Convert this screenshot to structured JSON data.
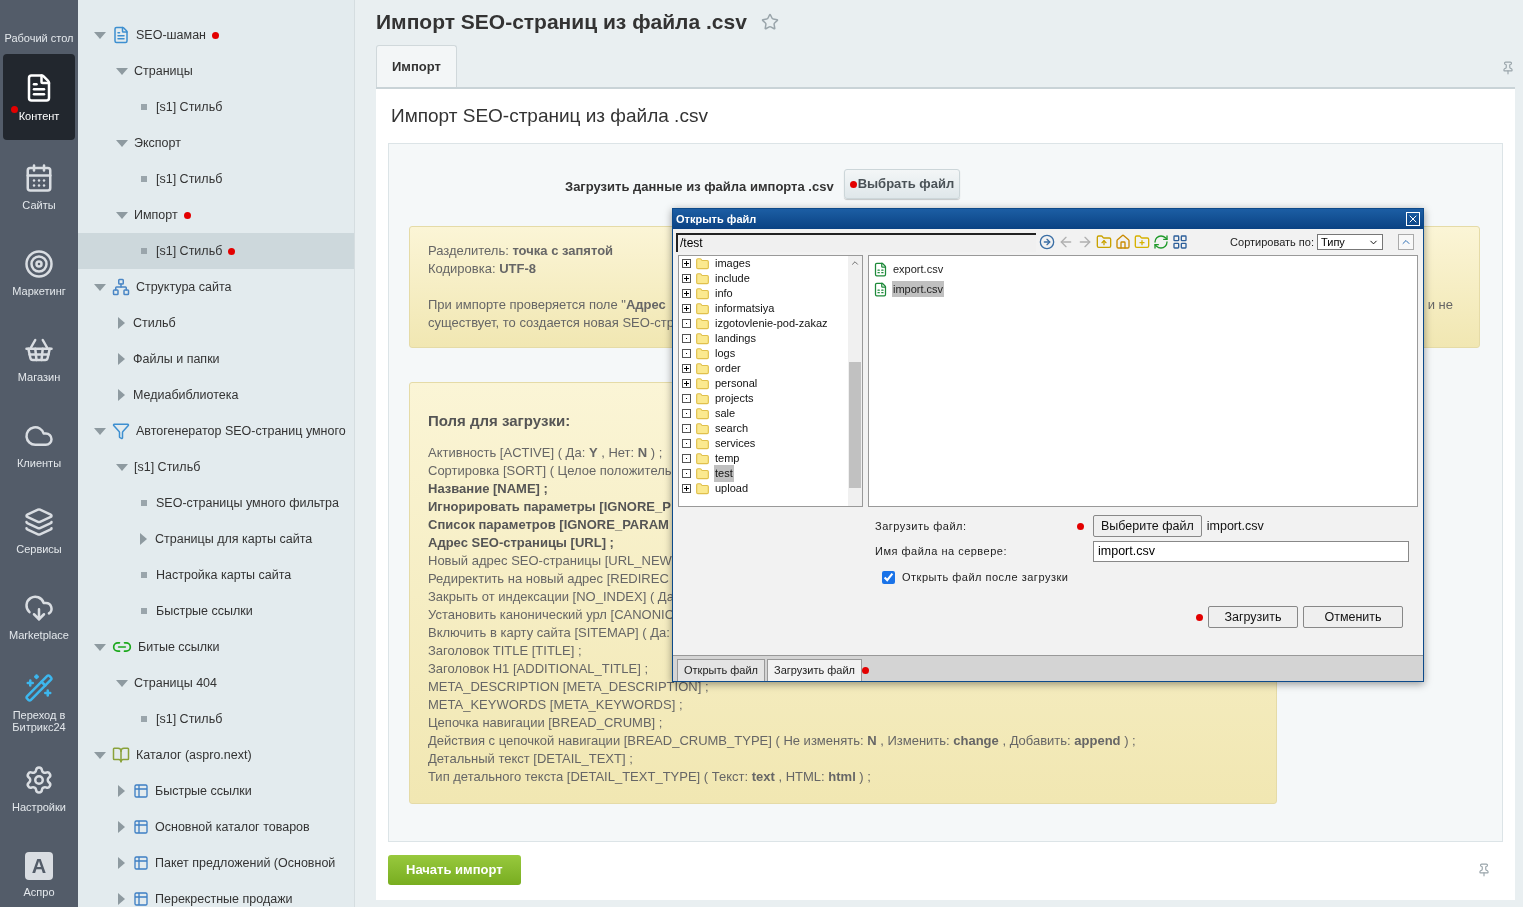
{
  "nav": [
    {
      "label": "Рабочий стол",
      "selected": false,
      "marked": false
    },
    {
      "label": "Контент",
      "selected": true,
      "marked": true
    },
    {
      "label": "Сайты",
      "selected": false,
      "marked": false
    },
    {
      "label": "Маркетинг",
      "selected": false,
      "marked": false
    },
    {
      "label": "Магазин",
      "selected": false,
      "marked": false
    },
    {
      "label": "Клиенты",
      "selected": false,
      "marked": false
    },
    {
      "label": "Сервисы",
      "selected": false,
      "marked": false
    },
    {
      "label": "Marketplace",
      "selected": false,
      "marked": false
    },
    {
      "label": "Переход в Битрикс24",
      "selected": false,
      "marked": false
    },
    {
      "label": "Настройки",
      "selected": false,
      "marked": false
    },
    {
      "label": "Аспро",
      "letter": "A",
      "selected": false,
      "marked": false
    }
  ],
  "tree": [
    {
      "label": "SEO-шаман",
      "kind": "folder",
      "expanded": true,
      "marked": true,
      "selected": false,
      "children": [
        {
          "label": "Страницы",
          "kind": "folder",
          "expanded": true,
          "marked": false,
          "selected": false,
          "children": [
            {
              "label": "[s1] Стильб",
              "kind": "leaf",
              "marked": false,
              "selected": false
            }
          ]
        },
        {
          "label": "Экспорт",
          "kind": "folder",
          "expanded": true,
          "marked": false,
          "selected": false,
          "children": [
            {
              "label": "[s1] Стильб",
              "kind": "leaf",
              "marked": false,
              "selected": false
            }
          ]
        },
        {
          "label": "Импорт",
          "kind": "folder",
          "expanded": true,
          "marked": true,
          "selected": false,
          "children": [
            {
              "label": "[s1] Стильб",
              "kind": "leaf",
              "marked": true,
              "selected": true
            }
          ]
        }
      ]
    },
    {
      "label": "Структура сайта",
      "kind": "folder",
      "expanded": true,
      "marked": false,
      "selected": false,
      "children": [
        {
          "label": "Стильб",
          "kind": "folder",
          "expanded": false,
          "marked": false,
          "selected": false
        },
        {
          "label": "Файлы и папки",
          "kind": "folder",
          "expanded": false,
          "marked": false,
          "selected": false
        },
        {
          "label": "Медиабиблиотека",
          "kind": "folder",
          "expanded": false,
          "marked": false,
          "selected": false
        }
      ]
    },
    {
      "label": "Автогенератор SEO-страниц умного",
      "kind": "folder",
      "expanded": true,
      "marked": false,
      "selected": false,
      "children": [
        {
          "label": "[s1] Стильб",
          "kind": "folder",
          "expanded": true,
          "marked": false,
          "selected": false,
          "children": [
            {
              "label": "SEO-страницы умного фильтра",
              "kind": "leaf",
              "marked": false,
              "selected": false
            },
            {
              "label": "Страницы для карты сайта",
              "kind": "folder",
              "expanded": false,
              "marked": false,
              "selected": false
            },
            {
              "label": "Настройка карты сайта",
              "kind": "leaf",
              "marked": false,
              "selected": false
            },
            {
              "label": "Быстрые ссылки",
              "kind": "leaf",
              "marked": false,
              "selected": false
            }
          ]
        }
      ]
    },
    {
      "label": "Битые ссылки",
      "kind": "folder",
      "expanded": true,
      "marked": false,
      "selected": false,
      "children": [
        {
          "label": "Страницы 404",
          "kind": "folder",
          "expanded": true,
          "marked": false,
          "selected": false,
          "children": [
            {
              "label": "[s1] Стильб",
              "kind": "leaf",
              "marked": false,
              "selected": false
            }
          ]
        }
      ]
    },
    {
      "label": "Каталог (aspro.next)",
      "kind": "folder",
      "expanded": true,
      "marked": false,
      "selected": false,
      "children": [
        {
          "label": "Быстрые ссылки",
          "kind": "folder",
          "expanded": false,
          "marked": false,
          "selected": false
        },
        {
          "label": "Основной каталог товаров",
          "kind": "folder",
          "expanded": false,
          "marked": false,
          "selected": false
        },
        {
          "label": "Пакет предложений (Основной",
          "kind": "folder",
          "expanded": false,
          "marked": false,
          "selected": false
        },
        {
          "label": "Перекрестные продажи",
          "kind": "folder",
          "expanded": false,
          "marked": false,
          "selected": false
        }
      ]
    }
  ],
  "page": {
    "title": "Импорт SEO-страниц из файла .csv",
    "tabs": [
      {
        "label": "Импорт",
        "selected": true
      }
    ],
    "heading": "Импорт SEO-страниц из файла .csv",
    "upload_label": "Загрузить данные из файла импорта .csv",
    "upload_button": {
      "label": "Выбрать файл",
      "marked": true
    },
    "info_lines": [
      "Разделитель: **точка с запятой**",
      "Кодировка: **UTF-8**"
    ],
    "info_paragraph": [
      "При импорте проверяется поле \"**Адрес**",
      "существует, то создается новая SEO-стр"
    ],
    "info_paragraph_tail": "и не",
    "fields_title": "Поля для загрузки:",
    "fields": [
      {
        "text": "Активность [ACTIVE] ( Да: **Y** , Нет: **N** ) ;",
        "bold": false
      },
      {
        "text": "Сортировка [SORT] ( Целое положитель",
        "bold": false
      },
      {
        "text": "Название [NAME] ;",
        "bold": true
      },
      {
        "text": "Игнорировать параметры [IGNORE_P",
        "bold": true
      },
      {
        "text": "Список параметров [IGNORE_PARAM",
        "bold": true
      },
      {
        "text": "Адрес SEO-страницы [URL] ;",
        "bold": true
      },
      {
        "text": "Новый адрес SEO-страницы [URL_NEW",
        "bold": false
      },
      {
        "text": "Редиректить на новый адрес [REDIREC",
        "bold": false
      },
      {
        "text": "Закрыть от индексации [NO_INDEX] ( Да",
        "bold": false
      },
      {
        "text": "Установить канонический урл [CANONIC",
        "bold": false
      },
      {
        "text": "Включить в карту сайта [SITEMAP] ( Да:",
        "bold": false
      },
      {
        "text": "Заголовок TITLE [TITLE] ;",
        "bold": false
      },
      {
        "text": "Заголовок H1 [ADDITIONAL_TITLE] ;",
        "bold": false
      },
      {
        "text": "META_DESCRIPTION [META_DESCRIPTION] ;",
        "bold": false
      },
      {
        "text": "META_KEYWORDS [META_KEYWORDS] ;",
        "bold": false
      },
      {
        "text": "Цепочка навигации [BREAD_CRUMB] ;",
        "bold": false
      },
      {
        "text": "Действия с цепочкой навигации [BREAD_CRUMB_TYPE] ( Не изменять: **N** , Изменить: **change** , Добавить: **append** ) ;",
        "bold": false
      },
      {
        "text": "Детальный текст [DETAIL_TEXT] ;",
        "bold": false
      },
      {
        "text": "Тип детального текста [DETAIL_TEXT_TYPE] ( Текст: **text** , HTML: **html** ) ;",
        "bold": false
      }
    ],
    "start_button": "Начать импорт"
  },
  "dialog": {
    "title": "Открыть файл",
    "path": "/test",
    "sort_label": "Сортировать по:",
    "sort_value": "Типу",
    "folders": [
      {
        "name": "images",
        "expandable": true,
        "selected": false
      },
      {
        "name": "include",
        "expandable": true,
        "selected": false
      },
      {
        "name": "info",
        "expandable": true,
        "selected": false
      },
      {
        "name": "informatsiya",
        "expandable": true,
        "selected": false
      },
      {
        "name": "izgotovlenie-pod-zakaz",
        "expandable": false,
        "selected": false
      },
      {
        "name": "landings",
        "expandable": false,
        "selected": false
      },
      {
        "name": "logs",
        "expandable": false,
        "selected": false
      },
      {
        "name": "order",
        "expandable": true,
        "selected": false
      },
      {
        "name": "personal",
        "expandable": true,
        "selected": false
      },
      {
        "name": "projects",
        "expandable": false,
        "selected": false
      },
      {
        "name": "sale",
        "expandable": false,
        "selected": false
      },
      {
        "name": "search",
        "expandable": false,
        "selected": false
      },
      {
        "name": "services",
        "expandable": false,
        "selected": false
      },
      {
        "name": "temp",
        "expandable": false,
        "selected": false
      },
      {
        "name": "test",
        "expandable": false,
        "selected": true
      },
      {
        "name": "upload",
        "expandable": true,
        "selected": false
      }
    ],
    "files": [
      {
        "name": "export.csv",
        "selected": false
      },
      {
        "name": "import.csv",
        "selected": true
      }
    ],
    "upload_label": "Загрузить файл:",
    "choose_button": {
      "label": "Выберите файл",
      "marked": true
    },
    "chosen_file": "import.csv",
    "server_name_label": "Имя файла на сервере:",
    "server_name": "import.csv",
    "open_after": {
      "label": "Открыть файл после загрузки",
      "checked": true
    },
    "buttons": [
      {
        "label": "Загрузить",
        "marked": true
      },
      {
        "label": "Отменить",
        "marked": false
      }
    ],
    "tabs": [
      {
        "label": "Открыть файл",
        "selected": false,
        "marked": false
      },
      {
        "label": "Загрузить файл",
        "selected": true,
        "marked": true
      }
    ]
  }
}
